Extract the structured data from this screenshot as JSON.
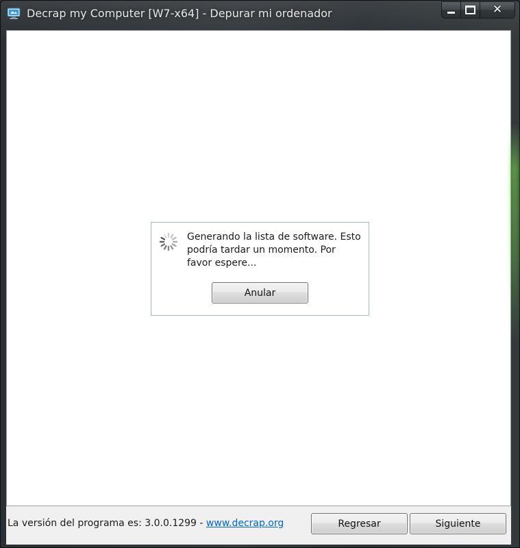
{
  "window": {
    "title": "Decrap my Computer [W7-x64] - Depurar mi ordenador",
    "icon": "app-monitor-icon",
    "controls": {
      "minimize_icon": "minimize-icon",
      "maximize_icon": "maximize-icon",
      "close_icon": "close-icon",
      "close_glyph": "✕"
    }
  },
  "progress_dialog": {
    "message": "Generando la lista de software. Esto podría tardar un momento. Por favor espere...",
    "spinner_icon": "loading-spinner-icon",
    "cancel_label": "Anular"
  },
  "footer": {
    "version_text": "La versión del programa es: 3.0.0.1299 - ",
    "website_link": "www.decrap.org",
    "back_label": "Regresar",
    "next_label": "Siguiente"
  },
  "colors": {
    "link": "#0066cc",
    "dialog_border": "#9dbad0",
    "frame": "#2f3437",
    "button_face": "#e5e5e5"
  }
}
